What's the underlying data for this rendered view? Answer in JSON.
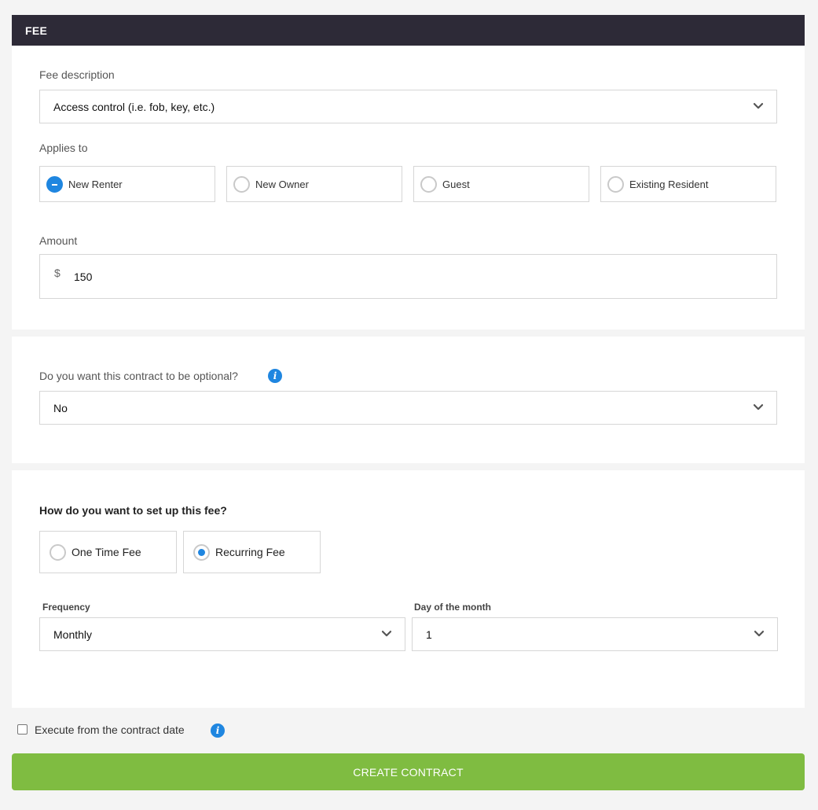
{
  "header": {
    "title": "FEE"
  },
  "fee_description": {
    "label": "Fee description",
    "value": "Access control (i.e. fob, key, etc.)"
  },
  "applies_to": {
    "label": "Applies to",
    "options": [
      {
        "label": "New Renter",
        "state": "minus"
      },
      {
        "label": "New Owner",
        "state": "unchecked"
      },
      {
        "label": "Guest",
        "state": "unchecked"
      },
      {
        "label": "Existing Resident",
        "state": "unchecked"
      }
    ]
  },
  "amount": {
    "label": "Amount",
    "currency_symbol": "$",
    "value": "150"
  },
  "optional": {
    "label": "Do you want this contract to be optional?",
    "value": "No"
  },
  "setup": {
    "question": "How do you want to set up this fee?",
    "options": [
      {
        "label": "One Time Fee",
        "selected": false
      },
      {
        "label": "Recurring Fee",
        "selected": true
      }
    ]
  },
  "frequency": {
    "label": "Frequency",
    "value": "Monthly"
  },
  "day_of_month": {
    "label": "Day of the month",
    "value": "1"
  },
  "execute": {
    "label": "Execute from the contract date",
    "checked": false
  },
  "create_button": {
    "label": "CREATE CONTRACT"
  },
  "colors": {
    "header_bg": "#2d2a37",
    "accent_blue": "#1f86e0",
    "button_green": "#7fbc41"
  }
}
